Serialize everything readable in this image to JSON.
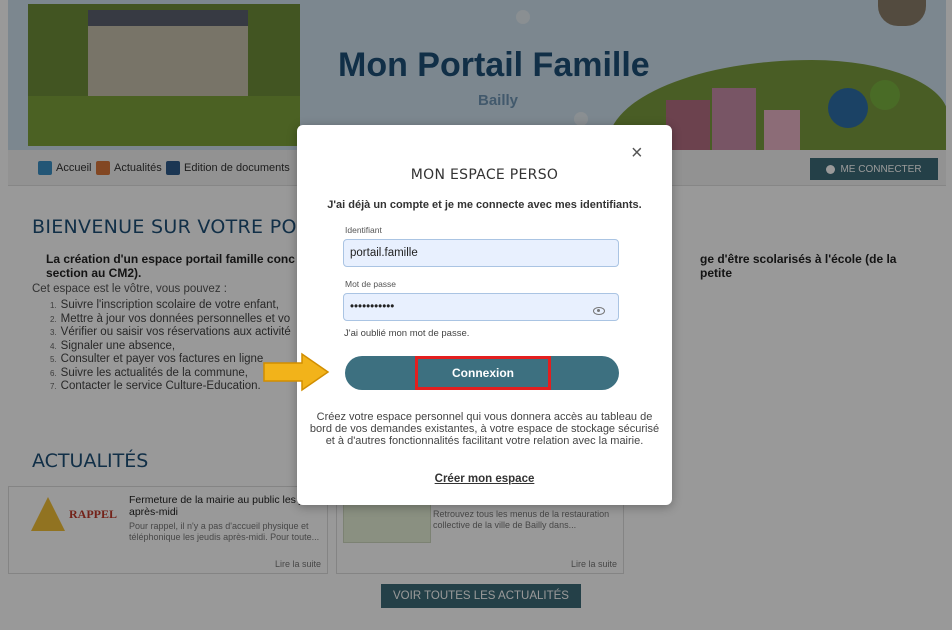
{
  "site": {
    "title": "Mon Portail Famille",
    "subtitle": "Bailly"
  },
  "nav": {
    "items": [
      {
        "label": "Accueil",
        "icon": "home-icon",
        "color": "#3b8fc5"
      },
      {
        "label": "Actualités",
        "icon": "news-icon",
        "color": "#d9773b"
      },
      {
        "label": "Edition de documents",
        "icon": "document-icon",
        "color": "#2d5b8a"
      }
    ],
    "login_label": "ME CONNECTER"
  },
  "welcome": {
    "title": "BIENVENUE SUR VOTRE PORTAIL FAM",
    "intro": "La création d'un espace portail famille conc",
    "intro_cont": "section au CM2).",
    "intro_right": "ge d'être scolarisés à l'école (de la petite",
    "espace": "Cet espace est le vôtre, vous pouvez :",
    "steps": [
      "Suivre l'inscription scolaire de votre enfant,",
      "Mettre à jour vos données personnelles et vo",
      "Vérifier ou saisir vos réservations aux activité",
      "Signaler une absence,",
      "Consulter et payer vos factures en ligne",
      "Suivre les actualités de la commune,",
      "Contacter le service Culture-Education."
    ]
  },
  "news": {
    "title": "ACTUALITÉS",
    "card1": {
      "badge": "RAPPEL",
      "title": "Fermeture de la mairie au public les jeudis",
      "title2": "après-midi",
      "text": "Pour rappel, il n'y a pas d'accueil physique et",
      "text2": "téléphonique les jeudis après-midi. Pour toute...",
      "more": "Lire la suite"
    },
    "card2": {
      "text": "Retrouvez tous les menus de la restauration",
      "text2": "collective de la ville de Bailly dans...",
      "more": "Lire la suite"
    },
    "see_all": "VOIR TOUTES LES ACTUALITÉS"
  },
  "modal": {
    "close": "×",
    "title": "MON ESPACE PERSO",
    "subtitle": "J'ai déjà un compte et je me connecte avec mes identifiants.",
    "id_label": "Identifiant",
    "id_value": "portail.famille",
    "pw_label": "Mot de passe",
    "pw_value": "•••••••••••",
    "forgot": "J'ai oublié mon mot de passe.",
    "submit": "Connexion",
    "create_text": "Créez votre espace personnel qui vous donnera accès au tableau de bord de vos demandes existantes, à votre espace de stockage sécurisé et à d'autres fonctionnalités facilitant votre relation avec la mairie.",
    "create_link": "Créer mon espace"
  },
  "colors": {
    "primary": "#3d6b78",
    "highlight": "#e31f1f",
    "arrow": "#f2b31a",
    "title": "#1d4f77"
  }
}
